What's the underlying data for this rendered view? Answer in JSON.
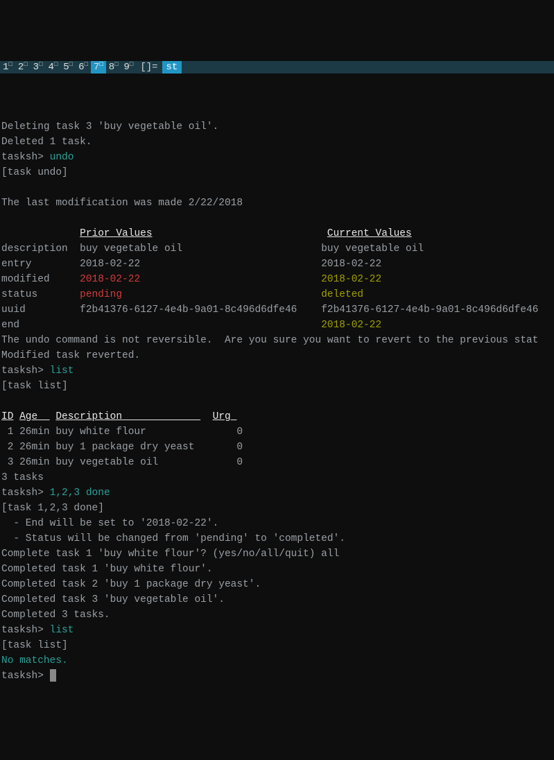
{
  "tabs": [
    "1",
    "2",
    "3",
    "4",
    "5",
    "6",
    "7",
    "8",
    "9"
  ],
  "activeTab": "7",
  "tabEnd": "[]=",
  "tabTitle": "st",
  "lines": {
    "del1": "Deleting task 3 'buy vegetable oil'.",
    "del2": "Deleted 1 task.",
    "prompt": "tasksh>",
    "cmdUndo": "undo",
    "echoUndo": "[task undo]",
    "lastMod": "The last modification was made 2/22/2018",
    "hdrPrior": "Prior Values",
    "hdrCurrent": "Current Values",
    "undoConfirm": "The undo command is not reversible.  Are you sure you want to revert to the previous stat",
    "reverted": "Modified task reverted.",
    "cmdList": "list",
    "echoList": "[task list]",
    "listHdrID": "ID",
    "listHdrAge": "Age",
    "listHdrDesc": "Description",
    "listHdrUrg": "Urg",
    "count": "3 tasks",
    "cmdDone": "1,2,3 done",
    "echoDone": "[task 1,2,3 done]",
    "doneNote1": "  - End will be set to '2018-02-22'.",
    "doneNote2": "  - Status will be changed from 'pending' to 'completed'.",
    "doneAsk": "Complete task 1 'buy white flour'? (yes/no/all/quit) all",
    "doneC1": "Completed task 1 'buy white flour'.",
    "doneC2": "Completed task 2 'buy 1 package dry yeast'.",
    "doneC3": "Completed task 3 'buy vegetable oil'.",
    "doneC4": "Completed 3 tasks.",
    "noMatches": "No matches."
  },
  "undoTable": {
    "rows": [
      {
        "field": "description",
        "prior": "buy vegetable oil",
        "current": "buy vegetable oil",
        "priorColor": "",
        "currentColor": ""
      },
      {
        "field": "entry",
        "prior": "2018-02-22",
        "current": "2018-02-22",
        "priorColor": "",
        "currentColor": ""
      },
      {
        "field": "modified",
        "prior": "2018-02-22",
        "current": "2018-02-22",
        "priorColor": "red",
        "currentColor": "olive"
      },
      {
        "field": "status",
        "prior": "pending",
        "current": "deleted",
        "priorColor": "red",
        "currentColor": "olive"
      },
      {
        "field": "uuid",
        "prior": "f2b41376-6127-4e4b-9a01-8c496d6dfe46",
        "current": "f2b41376-6127-4e4b-9a01-8c496d6dfe46",
        "priorColor": "",
        "currentColor": ""
      },
      {
        "field": "end",
        "prior": "",
        "current": "2018-02-22",
        "priorColor": "",
        "currentColor": "olive"
      }
    ]
  },
  "taskList": [
    {
      "id": "1",
      "age": "26min",
      "desc": "buy white flour",
      "urg": "0"
    },
    {
      "id": "2",
      "age": "26min",
      "desc": "buy 1 package dry yeast",
      "urg": "0"
    },
    {
      "id": "3",
      "age": "26min",
      "desc": "buy vegetable oil",
      "urg": "0"
    }
  ]
}
